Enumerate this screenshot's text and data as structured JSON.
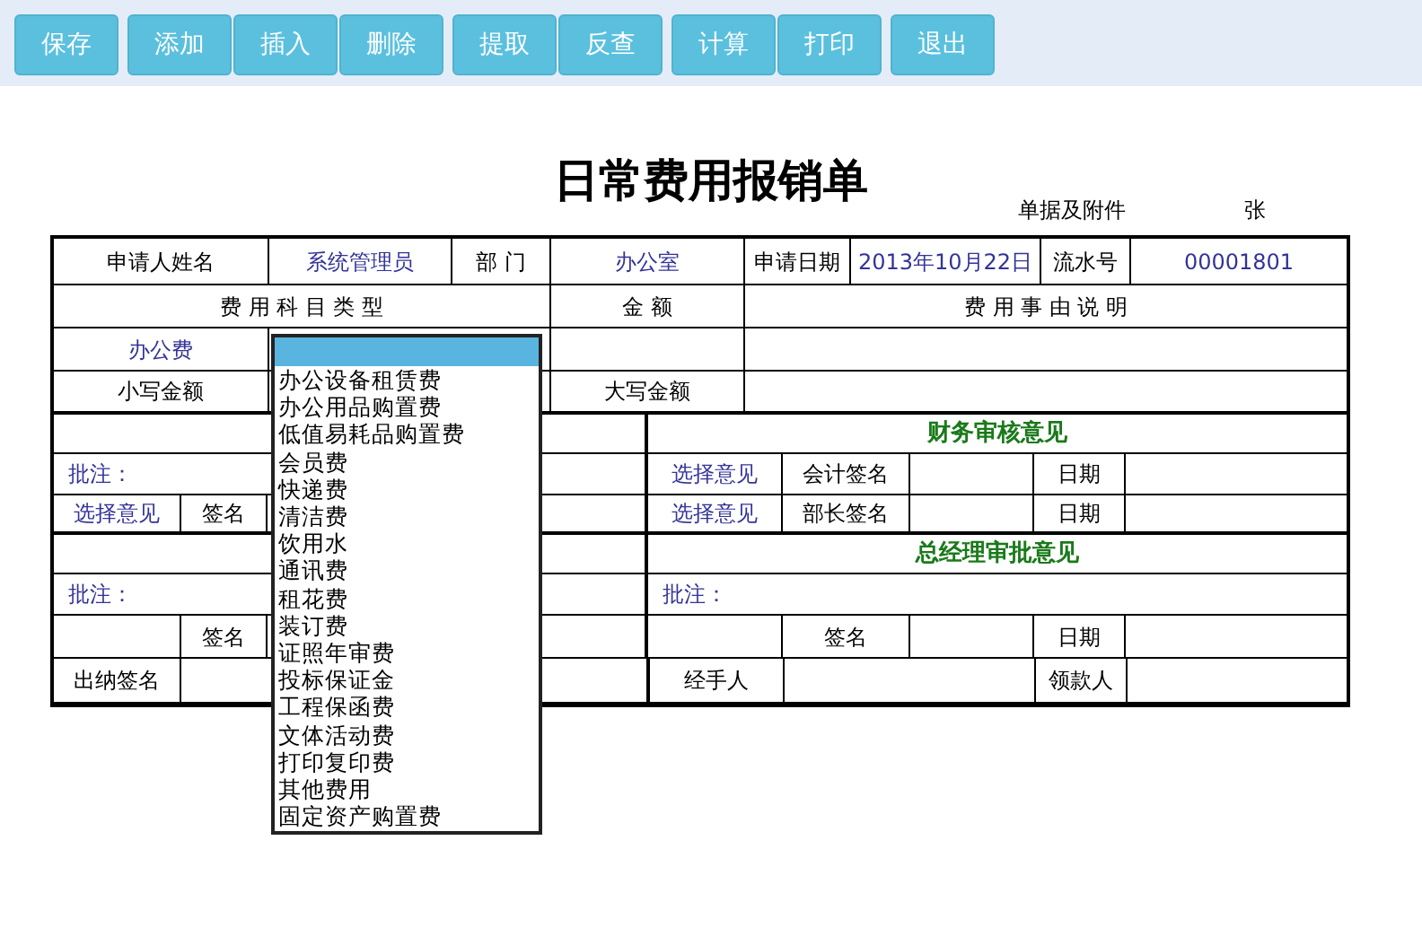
{
  "toolbar": [
    [
      "保存"
    ],
    [
      "添加",
      "插入",
      "删除"
    ],
    [
      "提取",
      "反查"
    ],
    [
      "计算",
      "打印"
    ],
    [
      "退出"
    ]
  ],
  "title": "日常费用报销单",
  "attachments": {
    "label": "单据及附件",
    "unit": "张"
  },
  "header_rows": [
    [
      {
        "kind": "label",
        "text": "申请人姓名"
      },
      {
        "kind": "value",
        "text": "系统管理员"
      },
      {
        "kind": "label",
        "text": "部 门"
      },
      {
        "kind": "value",
        "text": "办公室"
      },
      {
        "kind": "label",
        "text": "申请日期"
      },
      {
        "kind": "value",
        "text": "2013年10月22日"
      },
      {
        "kind": "label",
        "text": "流水号"
      },
      {
        "kind": "value",
        "text": "00001801"
      }
    ],
    [
      {
        "kind": "label",
        "text": "费 用 科 目 类 型"
      },
      {
        "kind": "label",
        "text": "金 额"
      },
      {
        "kind": "label",
        "text": "费 用 事 由 说 明"
      }
    ],
    [
      {
        "kind": "value",
        "text": "办公费"
      },
      {
        "kind": "blank"
      },
      {
        "kind": "blank"
      },
      {
        "kind": "blank"
      }
    ],
    [
      {
        "kind": "label",
        "text": "小写金额"
      },
      {
        "kind": "blank"
      },
      {
        "kind": "label",
        "text": "大写金额"
      },
      {
        "kind": "blank"
      }
    ]
  ],
  "approval_rows": [
    {
      "left": [
        {
          "kind": "blank"
        }
      ],
      "right": [
        {
          "kind": "heading",
          "text": "财务审核意见"
        }
      ]
    },
    {
      "left": [
        {
          "kind": "note",
          "text": "批注："
        }
      ],
      "right": [
        {
          "kind": "value",
          "text": "选择意见"
        },
        {
          "kind": "label",
          "text": "会计签名"
        },
        {
          "kind": "blank"
        },
        {
          "kind": "label",
          "text": "日期"
        },
        {
          "kind": "blank"
        }
      ]
    },
    {
      "left": [
        {
          "kind": "value",
          "text": "选择意见"
        },
        {
          "kind": "label",
          "text": "签名"
        },
        {
          "kind": "blank"
        }
      ],
      "right": [
        {
          "kind": "value",
          "text": "选择意见"
        },
        {
          "kind": "label",
          "text": "部长签名"
        },
        {
          "kind": "blank"
        },
        {
          "kind": "label",
          "text": "日期"
        },
        {
          "kind": "blank"
        }
      ]
    },
    {
      "left": [
        {
          "kind": "blank"
        }
      ],
      "right": [
        {
          "kind": "heading",
          "text": "总经理审批意见"
        }
      ]
    },
    {
      "left": [
        {
          "kind": "note",
          "text": "批注："
        }
      ],
      "right": [
        {
          "kind": "note",
          "text": "批注："
        }
      ]
    },
    {
      "left": [
        {
          "kind": "blank"
        },
        {
          "kind": "label",
          "text": "签名"
        },
        {
          "kind": "blank"
        }
      ],
      "right": [
        {
          "kind": "blank"
        },
        {
          "kind": "label",
          "text": "签名"
        },
        {
          "kind": "blank"
        },
        {
          "kind": "label",
          "text": "日期"
        },
        {
          "kind": "blank"
        }
      ]
    },
    {
      "left": [
        {
          "kind": "label",
          "text": "出纳签名"
        },
        {
          "kind": "blank"
        }
      ],
      "right": [
        {
          "kind": "label",
          "text": "经手人"
        },
        {
          "kind": "blank"
        },
        {
          "kind": "label",
          "text": "领款人"
        },
        {
          "kind": "blank"
        }
      ]
    }
  ],
  "dropdown": {
    "blank_option_selected": true,
    "options": [
      {
        "text": "办公设备租赁费",
        "selected": false
      },
      {
        "text": "办公用品购置费",
        "selected": false
      },
      {
        "text": "低值易耗品购置费",
        "selected": false
      },
      {
        "text": "会员费",
        "selected": false
      },
      {
        "text": "快递费",
        "selected": false
      },
      {
        "text": "清洁费",
        "selected": false
      },
      {
        "text": "饮用水",
        "selected": false
      },
      {
        "text": "通讯费",
        "selected": false
      },
      {
        "text": "租花费",
        "selected": false
      },
      {
        "text": "装订费",
        "selected": false
      },
      {
        "text": "证照年审费",
        "selected": false
      },
      {
        "text": "投标保证金",
        "selected": false
      },
      {
        "text": "工程保函费",
        "selected": false
      },
      {
        "text": "文体活动费",
        "selected": false
      },
      {
        "text": "打印复印费",
        "selected": false
      },
      {
        "text": "其他费用",
        "selected": false
      },
      {
        "text": "固定资产购置费",
        "selected": false
      }
    ]
  }
}
